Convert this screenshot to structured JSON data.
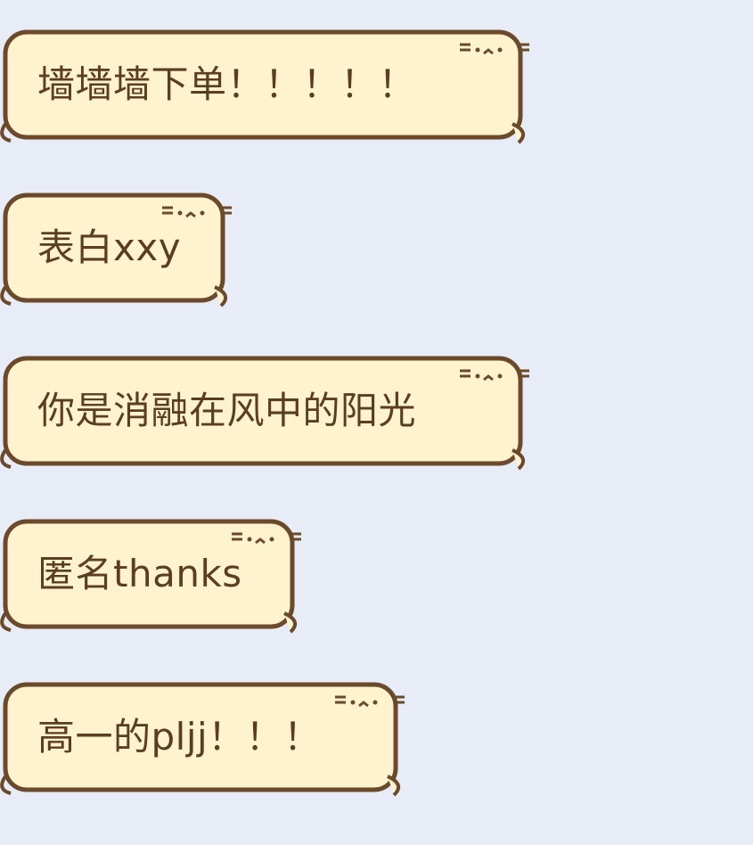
{
  "conversation": {
    "messages": [
      {
        "text": "墙墙墙下单！！！！！"
      },
      {
        "text": "表白xxy"
      },
      {
        "text": "你是消融在风中的阳光"
      },
      {
        "text": "匿名thanks"
      },
      {
        "text": "高一的pljj！！！"
      }
    ]
  },
  "theme": {
    "background": "#e8ecf6",
    "bubble_fill": "#fff2cf",
    "bubble_outline": "#6b4a2b",
    "text_color": "#5b3d22",
    "cat_patch": "#e07a3a",
    "bubble_icon": "cat-ear-icon"
  }
}
